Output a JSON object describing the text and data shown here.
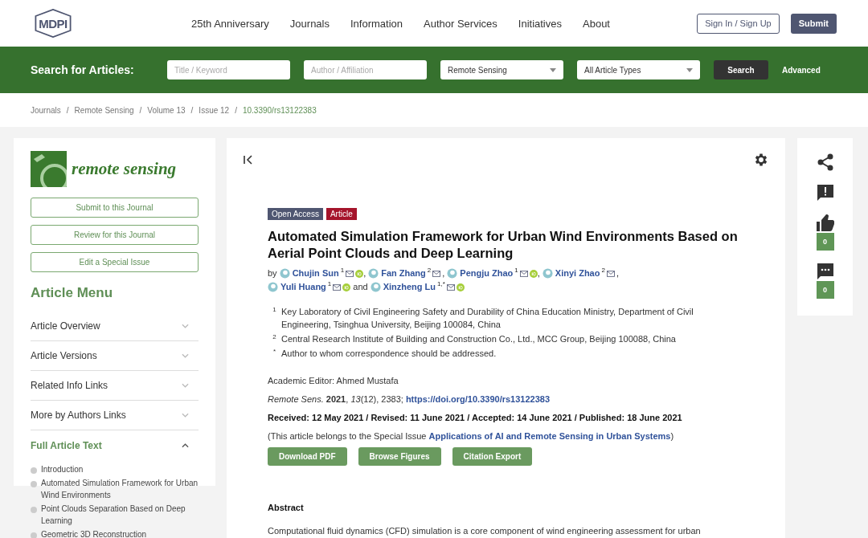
{
  "header": {
    "logo": "MDPI",
    "nav": [
      "25th Anniversary",
      "Journals",
      "Information",
      "Author Services",
      "Initiatives",
      "About"
    ],
    "sign_in": "Sign In / Sign Up",
    "submit": "Submit"
  },
  "search_bar": {
    "label": "Search for Articles:",
    "fields": [
      {
        "kind": "input",
        "placeholder": "Title / Keyword"
      },
      {
        "kind": "input",
        "placeholder": "Author / Affiliation"
      },
      {
        "kind": "select",
        "value": "Remote Sensing"
      },
      {
        "kind": "select",
        "value": "All Article Types"
      }
    ],
    "search": "Search",
    "advanced": "Advanced"
  },
  "breadcrumb": {
    "separator": "/",
    "items": [
      "Journals",
      "Remote Sensing",
      "Volume 13",
      "Issue 12",
      "10.3390/rs13122383"
    ]
  },
  "sidebar": {
    "journal": "remote sensing",
    "buttons": [
      "Submit to this Journal",
      "Review for this Journal",
      "Edit a Special Issue"
    ],
    "menu_title": "Article Menu",
    "items": [
      {
        "label": "Article Overview",
        "expanded": false
      },
      {
        "label": "Article Versions",
        "expanded": false
      },
      {
        "label": "Related Info Links",
        "expanded": false
      },
      {
        "label": "More by Authors Links",
        "expanded": false
      },
      {
        "label": "Full Article Text",
        "expanded": true,
        "children": [
          "Introduction",
          "Automated Simulation Framework for Urban Wind Environments",
          "Point Clouds Separation Based on Deep Learning",
          "Geometric 3D Reconstruction"
        ]
      }
    ]
  },
  "article": {
    "badges": [
      {
        "label": "Open Access",
        "color": "#4f5671"
      },
      {
        "label": "Article",
        "color": "#a5142b"
      }
    ],
    "title": "Automated Simulation Framework for Urban Wind Environments Based on Aerial Point Clouds and Deep Learning",
    "by": "by",
    "and": "and",
    "authors": [
      {
        "name": "Chujin Sun",
        "sup": "1",
        "orcid": true,
        "sep": ","
      },
      {
        "name": "Fan Zhang",
        "sup": "2",
        "orcid": false,
        "sep": ","
      },
      {
        "name": "Pengju Zhao",
        "sup": "1",
        "orcid": true,
        "sep": ","
      },
      {
        "name": "Xinyi Zhao",
        "sup": "2",
        "orcid": false,
        "sep": ","
      },
      {
        "name": "Yuli Huang",
        "sup": "1",
        "orcid": true
      },
      {
        "name": "Xinzheng Lu",
        "sup": "1,*",
        "orcid": true
      }
    ],
    "affiliations": [
      {
        "mark": "1",
        "text": "Key Laboratory of Civil Engineering Safety and Durability of China Education Ministry, Department of Civil Engineering, Tsinghua University, Beijing 100084, China"
      },
      {
        "mark": "2",
        "text": "Central Research Institute of Building and Construction Co., Ltd., MCC Group, Beijing 100088, China"
      },
      {
        "mark": "*",
        "text": "Author to whom correspondence should be addressed."
      }
    ],
    "editor": "Academic Editor: Ahmed Mustafa",
    "citation": "*Remote Sens.* **2021**, *13*(12), 2383;",
    "doi": "https://doi.org/10.3390/rs13122383",
    "dates": "Received: 12 May 2021 / Revised: 11 June 2021 / Accepted: 14 June 2021 / Published: 18 June 2021",
    "special_issue": {
      "prefix": "(This article belongs to the Special Issue",
      "link": "Applications of AI and Remote Sensing in Urban Systems",
      "suffix": ")"
    },
    "actions": [
      "Download PDF",
      "Browse Figures",
      "Citation Export"
    ],
    "abstract_title": "Abstract",
    "abstract": "Computational fluid dynamics (CFD) simulation is a core component of wind engineering assessment for urban"
  },
  "side_tools": [
    {
      "kind": "share"
    },
    {
      "kind": "comment-alert"
    },
    {
      "kind": "like",
      "count": "0"
    },
    {
      "kind": "comments",
      "count": "0"
    }
  ]
}
